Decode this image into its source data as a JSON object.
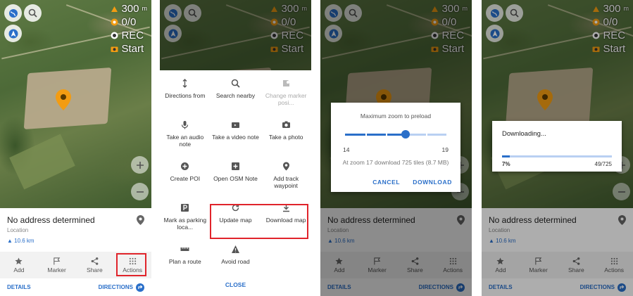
{
  "widgets": {
    "altitude": "300",
    "altitude_unit": "m",
    "trip": "0/0",
    "rec": "REC",
    "start": "Start"
  },
  "card": {
    "title": "No address determined",
    "subtitle": "Location",
    "distance": "10.6 km"
  },
  "actions": [
    {
      "label": "Add",
      "icon": "star-icon"
    },
    {
      "label": "Marker",
      "icon": "flag-icon"
    },
    {
      "label": "Share",
      "icon": "share-icon"
    },
    {
      "label": "Actions",
      "icon": "grid-dots-icon"
    }
  ],
  "bottom": {
    "details": "DETAILS",
    "directions": "DIRECTIONS"
  },
  "menu": {
    "items": [
      {
        "label": "Directions from",
        "icon": "directions-from-icon",
        "disabled": false
      },
      {
        "label": "Search nearby",
        "icon": "search-icon",
        "disabled": false
      },
      {
        "label": "Change marker posi...",
        "icon": "change-position-icon",
        "disabled": true
      },
      {
        "label": "Take an audio note",
        "icon": "microphone-icon",
        "disabled": false
      },
      {
        "label": "Take a video note",
        "icon": "video-icon",
        "disabled": false
      },
      {
        "label": "Take a photo",
        "icon": "camera-icon",
        "disabled": false
      },
      {
        "label": "Create POI",
        "icon": "poi-icon",
        "disabled": false
      },
      {
        "label": "Open OSM Note",
        "icon": "osm-note-icon",
        "disabled": false
      },
      {
        "label": "Add track waypoint",
        "icon": "waypoint-icon",
        "disabled": false
      },
      {
        "label": "Mark as parking loca...",
        "icon": "parking-icon",
        "disabled": false
      },
      {
        "label": "Update map",
        "icon": "refresh-icon",
        "disabled": false
      },
      {
        "label": "Download map",
        "icon": "download-icon",
        "disabled": false
      },
      {
        "label": "Plan a route",
        "icon": "ruler-icon",
        "disabled": false
      },
      {
        "label": "Avoid road",
        "icon": "warning-icon",
        "disabled": false
      }
    ],
    "close": "CLOSE"
  },
  "preload_dialog": {
    "title": "Maximum zoom to preload",
    "min": "14",
    "max": "19",
    "selected_zoom": 17,
    "info": "At zoom 17 download 725 tiles (8.7 MB)",
    "cancel": "CANCEL",
    "download": "DOWNLOAD"
  },
  "download_dialog": {
    "title": "Downloading...",
    "percent": "7%",
    "progress": 0.07,
    "count": "49/725"
  },
  "colors": {
    "accent": "#2a6fc9",
    "highlight": "#e0242b",
    "pin": "#f39c12"
  }
}
